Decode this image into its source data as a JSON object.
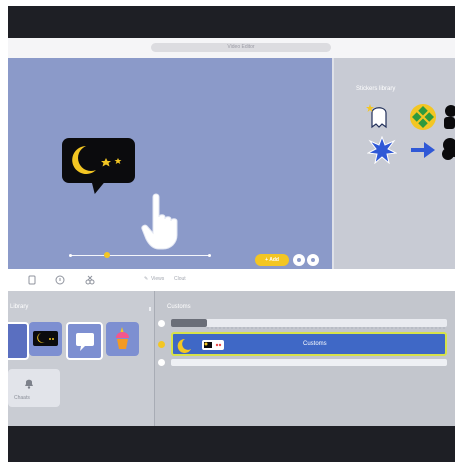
{
  "window": {
    "title": "Video Editor"
  },
  "canvas": {
    "add_button": "+ Add",
    "background_color": "#8b9ac9",
    "bubble_icon": "moon-stars-speech-bubble",
    "cursor_icon": "hand-pointer-icon"
  },
  "stickers": {
    "title": "Stickers library",
    "items": [
      "ghost-sticker",
      "green-diamond-sticker",
      "silhouette-sticker",
      "blue-splash-sticker",
      "blue-arrow-sticker",
      "black-cloud-sticker"
    ]
  },
  "toolbar": {
    "icons": [
      "page-icon",
      "help-icon",
      "scissors-icon"
    ],
    "edit_label": "Views",
    "clone_label": "Clout"
  },
  "library": {
    "title": "Library",
    "chaats_label": "Chaats"
  },
  "timeline": {
    "title": "Customs",
    "track_label": "Customs"
  },
  "colors": {
    "accent": "#f3c623",
    "track": "#3f68c6",
    "track_border": "#d7e24a"
  }
}
